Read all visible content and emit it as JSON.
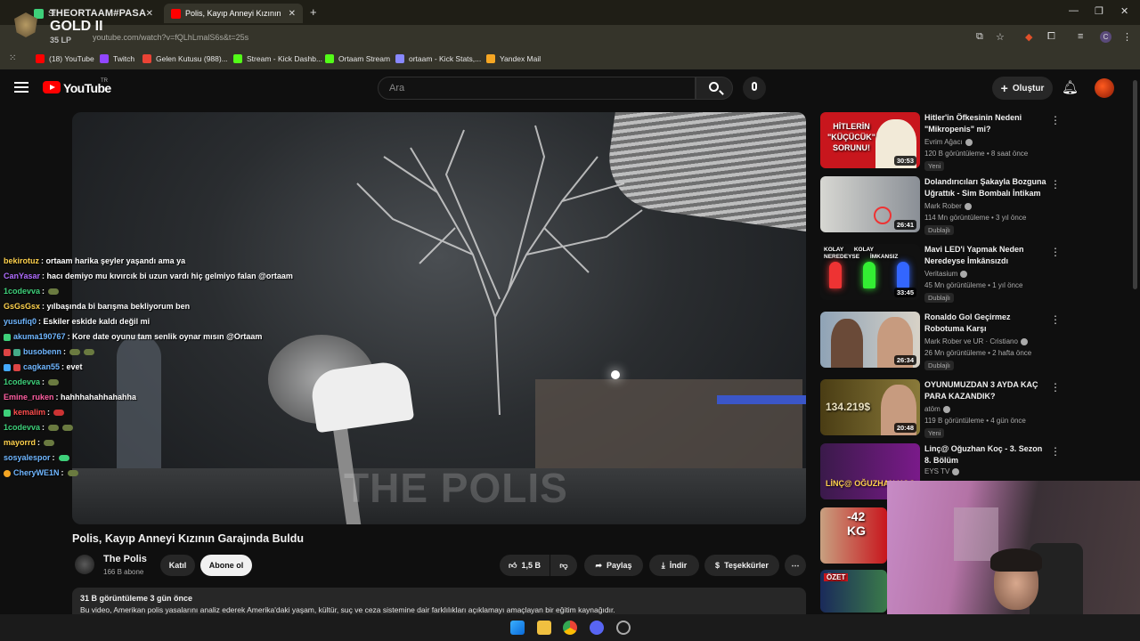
{
  "browser": {
    "tabs": [
      {
        "label": "St"
      },
      {
        "label": "Polis, Kayıp Anneyi Kızının Garaj"
      }
    ],
    "new_tab": "+",
    "url": "youtube.com/watch?v=fQLhLmalS6s&t=25s",
    "bookmarks": [
      {
        "label": "(18) YouTube",
        "color": "#ff0000"
      },
      {
        "label": "Twitch",
        "color": "#9146ff"
      },
      {
        "label": "Gelen Kutusu (988)...",
        "color": "#ea4335"
      },
      {
        "label": "Stream - Kick Dashb...",
        "color": "#53fc18"
      },
      {
        "label": "Ortaam Stream",
        "color": "#53fc18"
      },
      {
        "label": "ortaam - Kick Stats,...",
        "color": "#8888ff"
      },
      {
        "label": "Yandex Mail",
        "color": "#f5a623"
      }
    ]
  },
  "overlay": {
    "rank_name": "THEORTAAM#PASA",
    "rank_tier": "GOLD II",
    "rank_lp": "35 LP"
  },
  "youtube": {
    "logo_text": "YouTube",
    "logo_sup": "TR",
    "search_placeholder": "Ara",
    "create_label": "Oluştur"
  },
  "video": {
    "watermark": "THE POLIS",
    "title": "Polis, Kayıp Anneyi Kızının Garajında Buldu",
    "channel": "The Polis",
    "subs": "166 B abone",
    "join_label": "Katıl",
    "subscribe_label": "Abone ol",
    "likes": "1,5 B",
    "share_label": "Paylaş",
    "download_label": "İndir",
    "thanks_label": "Teşekkürler",
    "stats": "31 B görüntüleme  3 gün önce",
    "description": "Bu video, Amerikan polis yasalarını analiz ederek Amerika'daki yaşam, kültür, suç ve ceza sistemine dair farklılıkları açıklamayı amaçlayan bir eğitim kaynağıdır."
  },
  "chat": [
    {
      "user": "bekirotuz",
      "color": "#ffd24d",
      "msg": ": ortaam harika şeyler yaşandı ama ya"
    },
    {
      "user": "CanYasar",
      "color": "#b06cff",
      "msg": ": hacı demiyo mu kıvırcık bi uzun vardı hiç gelmiyo falan @ortaam"
    },
    {
      "user": "1codevva",
      "color": "#3ed07a",
      "msg": ":"
    },
    {
      "user": "GsGsGsx",
      "color": "#ffd24d",
      "msg": ": yılbaşında bi barışma bekliyorum ben"
    },
    {
      "user": "yusufiq0",
      "color": "#6fb6ff",
      "msg": ": Eskiler eskide kaldı değil mi"
    },
    {
      "user": "akuma190767",
      "color": "#6fb6ff",
      "msg": ": Kore date oyunu tam senlik oynar mısın @Ortaam"
    },
    {
      "user": "busobenn",
      "color": "#6fb6ff",
      "msg": ":"
    },
    {
      "user": "cagkan55",
      "color": "#6fb6ff",
      "msg": ": evet"
    },
    {
      "user": "1codevva",
      "color": "#3ed07a",
      "msg": ":"
    },
    {
      "user": "Emine_ruken",
      "color": "#ff5fa2",
      "msg": ": hahhhahahhahahha"
    },
    {
      "user": "kemalim",
      "color": "#ff4d4d",
      "msg": ":"
    },
    {
      "user": "1codevva",
      "color": "#3ed07a",
      "msg": ":"
    },
    {
      "user": "mayorrd",
      "color": "#ffd24d",
      "msg": ":"
    },
    {
      "user": "sosyalespor",
      "color": "#6fb6ff",
      "msg": ":"
    },
    {
      "user": "CheryWE1N",
      "color": "#6fb6ff",
      "msg": ":"
    }
  ],
  "recommendations": [
    {
      "title": "Hitler'in Öfkesinin Nedeni \"Mikropenis\" mi?",
      "channel": "Evrim Ağacı",
      "meta": "120 B görüntüleme • 8 saat önce",
      "tag": "Yeni",
      "duration": "30:53",
      "thumb_text": "HİTLERİN \"KÜÇÜCÜK\" SORUNU!",
      "thumb_color": "#c8161d"
    },
    {
      "title": "Dolandırıcıları Şakayla Bozguna Uğrattık - Sim Bombalı İntikam",
      "channel": "Mark Rober",
      "meta": "114 Mn görüntüleme • 3 yıl önce",
      "tag": "Dublajlı",
      "duration": "26:41",
      "thumb_text": "",
      "thumb_color": "#d7d7d2"
    },
    {
      "title": "Mavi LED'i Yapmak Neden Neredeyse İmkânsızdı",
      "channel": "Veritasium",
      "meta": "45 Mn görüntüleme • 1 yıl önce",
      "tag": "Dublajlı",
      "duration": "33:45",
      "thumb_text": "KOLAY KOLAY NEREDEYSE İMKANSIZ",
      "thumb_color": "#111111"
    },
    {
      "title": "Ronaldo Gol Geçirmez Robotuma Karşı",
      "channel": "Mark Rober ve UR · Cristiano",
      "meta": "26 Mn görüntüleme • 2 hafta önce",
      "tag": "Dublajlı",
      "duration": "26:34",
      "thumb_text": "",
      "thumb_color": "#a9b5c2"
    },
    {
      "title": "OYUNUMUZDAN 3 AYDA KAÇ PARA KAZANDIK?",
      "channel": "atöm",
      "meta": "119 B görüntüleme • 4 gün önce",
      "tag": "Yeni",
      "duration": "20:48",
      "thumb_text": "134.219$",
      "thumb_color": "#5a4a1a"
    },
    {
      "title": "Linç@ Oğuzhan Koç - 3. Sezon 8. Bölüm",
      "channel": "EYS TV",
      "meta": "",
      "tag": "",
      "duration": "",
      "thumb_text": "LİNÇ@ OĞUZHAN KOÇ",
      "thumb_color": "#7a1a8a"
    },
    {
      "title": "",
      "channel": "",
      "meta": "",
      "tag": "",
      "duration": "",
      "thumb_text": "-42 KG",
      "thumb_color": "#c8161d"
    },
    {
      "title": "",
      "channel": "",
      "meta": "",
      "tag": "",
      "duration": "",
      "thumb_text": "ÖZET",
      "thumb_color": "#1a2a5a"
    }
  ]
}
